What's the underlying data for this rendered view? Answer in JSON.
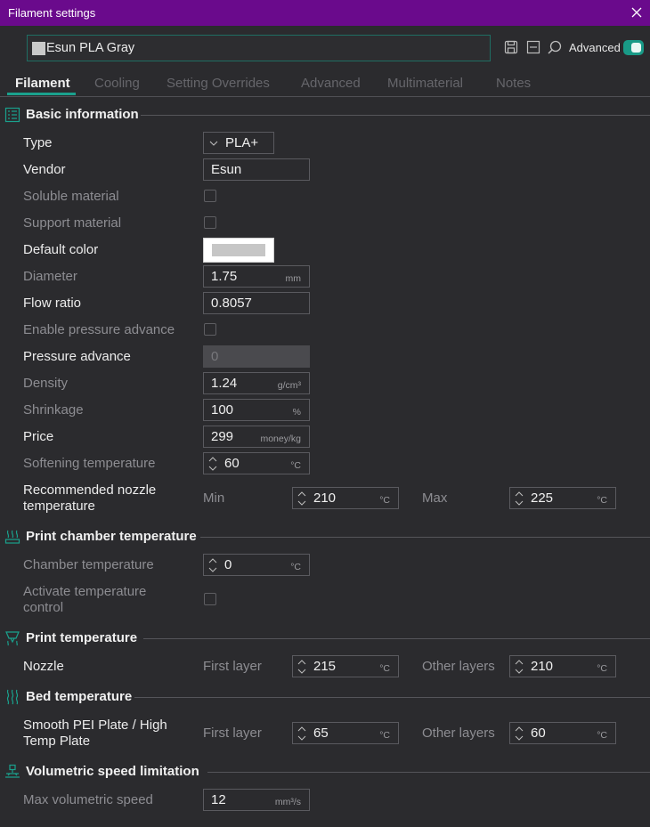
{
  "window": {
    "title": "Filament settings"
  },
  "preset": {
    "name": "Esun PLA Gray",
    "swatch_color": "#c9c9c9"
  },
  "toolbar": {
    "advanced_label": "Advanced",
    "advanced_on": true,
    "accent": "#1aa18d"
  },
  "tabs": [
    {
      "label": "Filament",
      "active": true
    },
    {
      "label": "Cooling",
      "active": false
    },
    {
      "label": "Setting Overrides",
      "active": false
    },
    {
      "label": "Advanced",
      "active": false
    },
    {
      "label": "Multimaterial",
      "active": false
    },
    {
      "label": "Notes",
      "active": false
    }
  ],
  "basic": {
    "title": "Basic information",
    "type_label": "Type",
    "type_value": "PLA+",
    "vendor_label": "Vendor",
    "vendor_value": "Esun",
    "soluble_label": "Soluble material",
    "soluble_checked": false,
    "support_label": "Support material",
    "support_checked": false,
    "color_label": "Default color",
    "color_value": "#c6c6c6",
    "diameter_label": "Diameter",
    "diameter_value": "1.75",
    "diameter_unit": "mm",
    "flow_label": "Flow ratio",
    "flow_value": "0.8057",
    "enable_pa_label": "Enable pressure advance",
    "enable_pa_checked": false,
    "pa_label": "Pressure advance",
    "pa_value": "0",
    "density_label": "Density",
    "density_value": "1.24",
    "density_unit": "g/cm³",
    "shrink_label": "Shrinkage",
    "shrink_value": "100",
    "shrink_unit": "%",
    "price_label": "Price",
    "price_value": "299",
    "price_unit": "money/kg",
    "soften_label": "Softening temperature",
    "soften_value": "60",
    "soften_unit": "°C",
    "nozzle_rec_label_1": "Recommended nozzle",
    "nozzle_rec_label_2": "temperature",
    "min_label": "Min",
    "min_value": "210",
    "min_unit": "°C",
    "max_label": "Max",
    "max_value": "225",
    "max_unit": "°C"
  },
  "chamber": {
    "title": "Print chamber temperature",
    "temp_label": "Chamber temperature",
    "temp_value": "0",
    "temp_unit": "°C",
    "activate_label_1": "Activate temperature",
    "activate_label_2": "control",
    "activate_checked": false
  },
  "print_temp": {
    "title": "Print temperature",
    "nozzle_label": "Nozzle",
    "first_label": "First layer",
    "first_value": "215",
    "first_unit": "°C",
    "other_label": "Other layers",
    "other_value": "210",
    "other_unit": "°C"
  },
  "bed": {
    "title": "Bed temperature",
    "plate_label_1": "Smooth PEI Plate / High",
    "plate_label_2": "Temp Plate",
    "first_label": "First layer",
    "first_value": "65",
    "first_unit": "°C",
    "other_label": "Other layers",
    "other_value": "60",
    "other_unit": "°C"
  },
  "volumetric": {
    "title": "Volumetric speed limitation",
    "max_label": "Max volumetric speed",
    "max_value": "12",
    "max_unit": "mm³/s"
  }
}
